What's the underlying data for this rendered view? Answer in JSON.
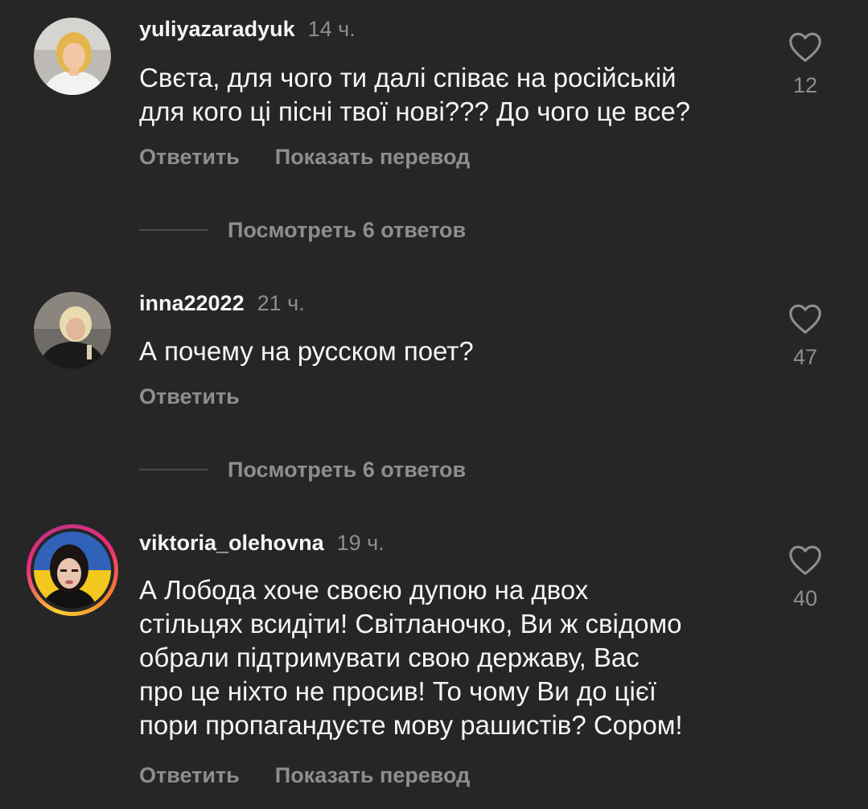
{
  "comments": [
    {
      "username": "yuliyazaradyuk",
      "time": "14 ч.",
      "text": "Свєта, для чого ти далі співає на російській\nдля кого ці пісні твої нові??? До чого це все?",
      "reply_label": "Ответить",
      "translate_label": "Показать перевод",
      "likes": "12",
      "view_replies": "Посмотреть 6 ответов"
    },
    {
      "username": "inna22022",
      "time": "21 ч.",
      "text": "А почему на русском поет?",
      "reply_label": "Ответить",
      "likes": "47",
      "view_replies": "Посмотреть 6 ответов"
    },
    {
      "username": "viktoria_olehovna",
      "time": "19 ч.",
      "text": "А Лобода хоче своєю дупою на двох\nстільцях всидіти! Світланочко, Ви ж свідомо\nобрали підтримувати свою державу, Вас\nпро це ніхто не просив! То чому Ви до цієї\nпори пропагандуєте мову рашистів? Сором!",
      "reply_label": "Ответить",
      "translate_label": "Показать перевод",
      "likes": "40"
    }
  ],
  "icons": {
    "like": "heart-outline-icon"
  },
  "colors": {
    "background": "#262626",
    "primary_text": "#f5f5f5",
    "secondary_text": "#8e8e8e"
  }
}
